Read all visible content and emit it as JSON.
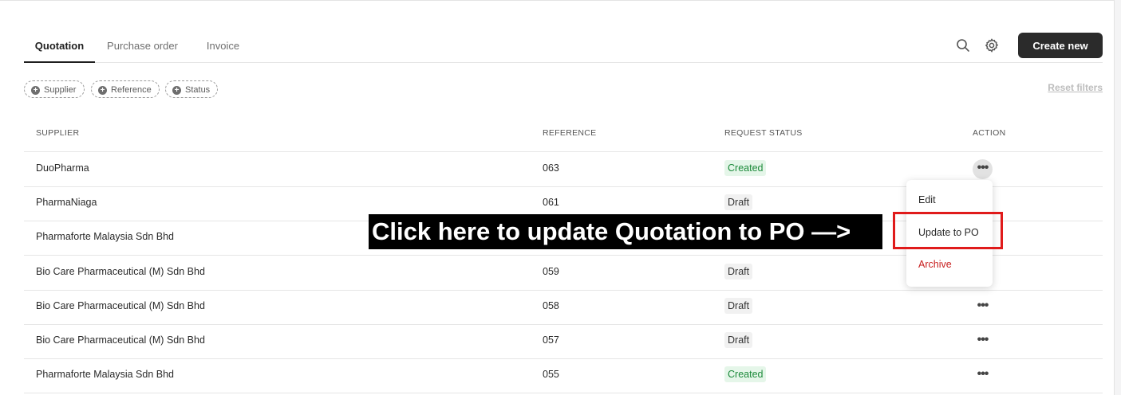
{
  "tabs": [
    {
      "label": "Quotation",
      "active": true
    },
    {
      "label": "Purchase order",
      "active": false
    },
    {
      "label": "Invoice",
      "active": false
    }
  ],
  "toolbar": {
    "search_icon": "search-icon",
    "settings_icon": "gear-icon",
    "create_label": "Create new"
  },
  "filters": {
    "chips": [
      {
        "label": "Supplier"
      },
      {
        "label": "Reference"
      },
      {
        "label": "Status"
      }
    ],
    "reset_label": "Reset filters"
  },
  "table": {
    "columns": [
      "SUPPLIER",
      "REFERENCE",
      "REQUEST STATUS",
      "ACTION"
    ],
    "rows": [
      {
        "supplier": "DuoPharma",
        "reference": "063",
        "status": "Created"
      },
      {
        "supplier": "PharmaNiaga",
        "reference": "061",
        "status": "Draft"
      },
      {
        "supplier": "Pharmaforte Malaysia Sdn Bhd",
        "reference": "",
        "status": ""
      },
      {
        "supplier": "Bio Care Pharmaceutical (M) Sdn Bhd",
        "reference": "059",
        "status": "Draft"
      },
      {
        "supplier": "Bio Care Pharmaceutical (M) Sdn Bhd",
        "reference": "058",
        "status": "Draft"
      },
      {
        "supplier": "Bio Care Pharmaceutical (M) Sdn Bhd",
        "reference": "057",
        "status": "Draft"
      },
      {
        "supplier": "Pharmaforte Malaysia Sdn Bhd",
        "reference": "055",
        "status": "Created"
      }
    ]
  },
  "action_menu": {
    "items": [
      {
        "label": "Edit"
      },
      {
        "label": "Update to PO"
      },
      {
        "label": "Archive"
      }
    ]
  },
  "annotation": {
    "text": "Click here to update Quotation to PO —>"
  },
  "colors": {
    "primary_button": "#2b2b2b",
    "created_badge_bg": "#e5f6e9",
    "created_badge_text": "#1c8a3a",
    "archive_text": "#c81e1e",
    "highlight_border": "#e01b1b"
  }
}
